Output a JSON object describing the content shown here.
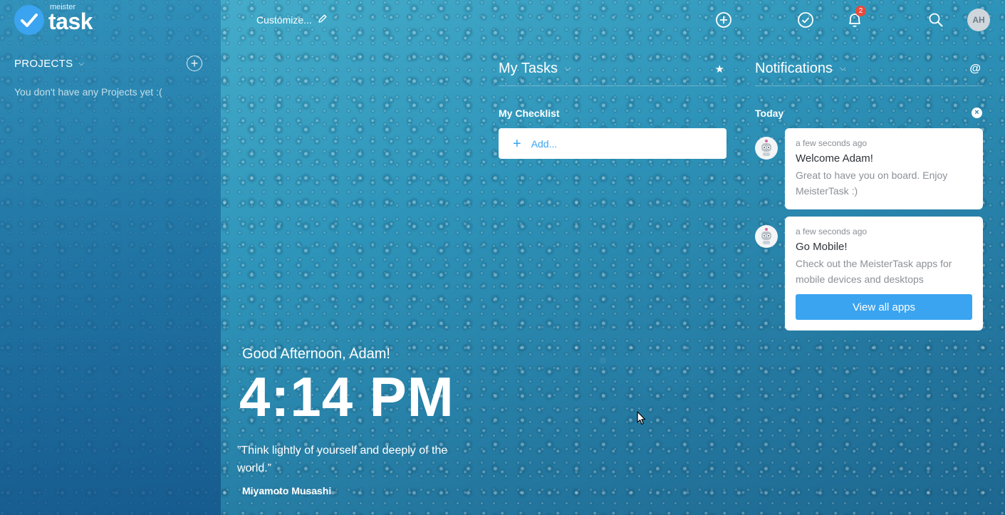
{
  "app": {
    "logo_small": "meister",
    "logo_main": "task"
  },
  "sidebar": {
    "projects_label": "PROJECTS",
    "empty_text": "You don't have any Projects yet :("
  },
  "topbar": {
    "customize_label": "Customize...",
    "notification_count": "2",
    "avatar_initials": "AH"
  },
  "tasks": {
    "title": "My Tasks",
    "checklist_label": "My Checklist",
    "add_placeholder": "Add..."
  },
  "notifications": {
    "title": "Notifications",
    "at_symbol": "@",
    "group_label": "Today",
    "items": [
      {
        "time": "a few seconds ago",
        "title": "Welcome Adam!",
        "body": "Great to have you on board. Enjoy MeisterTask :)"
      },
      {
        "time": "a few seconds ago",
        "title": "Go Mobile!",
        "body": "Check out the MeisterTask apps for mobile devices and desktops",
        "button_label": "View all apps"
      }
    ]
  },
  "dashboard": {
    "greeting": "Good Afternoon, Adam!",
    "time": "4:14 PM",
    "quote": "”Think lightly of yourself and deeply of the world.”",
    "author": "Miyamoto Musashi"
  },
  "colors": {
    "accent": "#3aa4f0",
    "badge": "#e84a3c"
  }
}
